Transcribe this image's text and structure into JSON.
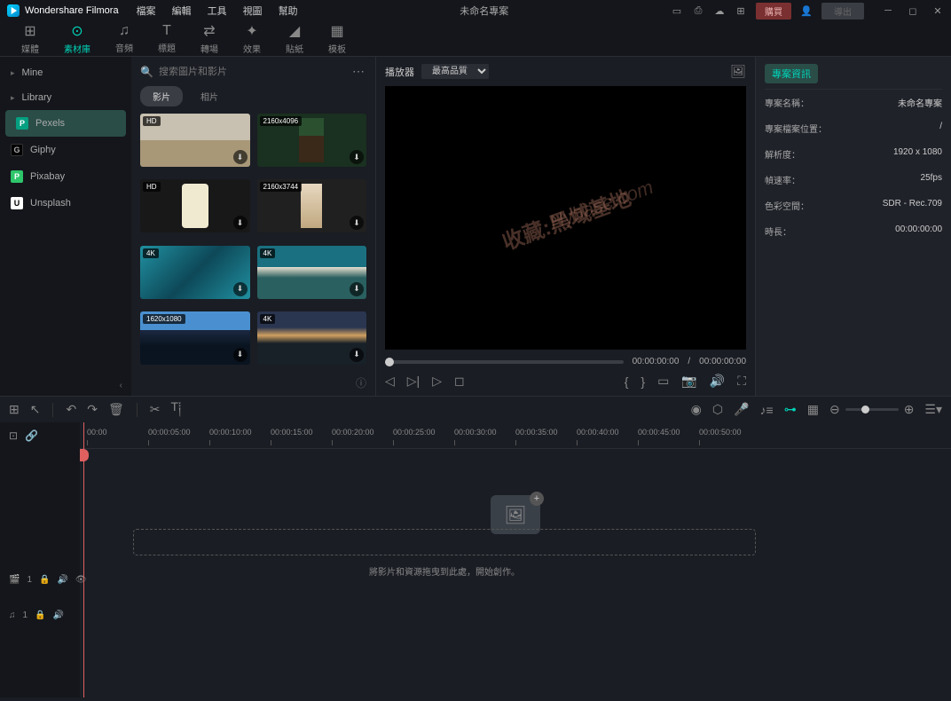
{
  "app": {
    "name": "Wondershare Filmora",
    "title": "未命名專案"
  },
  "menus": [
    "檔案",
    "編輯",
    "工具",
    "視圖",
    "幫助"
  ],
  "titlebar": {
    "buy": "購買",
    "export": "導出"
  },
  "toolbar": [
    {
      "label": "媒體",
      "icon": "⊞"
    },
    {
      "label": "素材庫",
      "icon": "⊙",
      "active": true
    },
    {
      "label": "音頻",
      "icon": "♫"
    },
    {
      "label": "標題",
      "icon": "T"
    },
    {
      "label": "轉場",
      "icon": "⇄"
    },
    {
      "label": "效果",
      "icon": "✦"
    },
    {
      "label": "貼紙",
      "icon": "◢"
    },
    {
      "label": "模板",
      "icon": "▦"
    }
  ],
  "sidebar": {
    "items": [
      {
        "label": "Mine",
        "chev": true
      },
      {
        "label": "Library",
        "chev": true
      },
      {
        "label": "Pexels",
        "icon": "pexels",
        "active": true
      },
      {
        "label": "Giphy",
        "icon": "giphy"
      },
      {
        "label": "Pixabay",
        "icon": "pixabay"
      },
      {
        "label": "Unsplash",
        "icon": "unsplash"
      }
    ]
  },
  "search": {
    "placeholder": "搜索圖片和影片"
  },
  "subtabs": [
    {
      "label": "影片",
      "active": true
    },
    {
      "label": "相片"
    }
  ],
  "thumbs": [
    {
      "badge": "HD",
      "cls": "beach"
    },
    {
      "badge": "2160x4096",
      "cls": "forest"
    },
    {
      "badge": "HD",
      "cls": "hand"
    },
    {
      "badge": "2160x3744",
      "cls": "blossom"
    },
    {
      "badge": "4K",
      "cls": "ocean1"
    },
    {
      "badge": "4K",
      "cls": "ocean2"
    },
    {
      "badge": "1620x1080",
      "cls": "mountain"
    },
    {
      "badge": "4K",
      "cls": "sunset"
    }
  ],
  "preview": {
    "tab": "播放器",
    "quality": "最高品質",
    "time_current": "00:00:00:00",
    "time_total": "00:00:00:00",
    "watermark1": "收藏:黑域基地",
    "watermark2": "Hybase.com"
  },
  "info": {
    "tab": "專案資訊",
    "rows": [
      {
        "k": "專案名稱：",
        "v": "未命名專案"
      },
      {
        "k": "專案檔案位置：",
        "v": "/"
      },
      {
        "k": "解析度：",
        "v": "1920 x 1080"
      },
      {
        "k": "幀速率：",
        "v": "25fps"
      },
      {
        "k": "色彩空間：",
        "v": "SDR - Rec.709"
      },
      {
        "k": "時長：",
        "v": "00:00:00:00"
      }
    ]
  },
  "timeline": {
    "ticks": [
      "00:00",
      "00:00:05:00",
      "00:00:10:00",
      "00:00:15:00",
      "00:00:20:00",
      "00:00:25:00",
      "00:00:30:00",
      "00:00:35:00",
      "00:00:40:00",
      "00:00:45:00",
      "00:00:50:00"
    ],
    "droptext": "將影片和資源拖曳到此處，開始創作。",
    "video_track": "1",
    "audio_track": "1"
  }
}
